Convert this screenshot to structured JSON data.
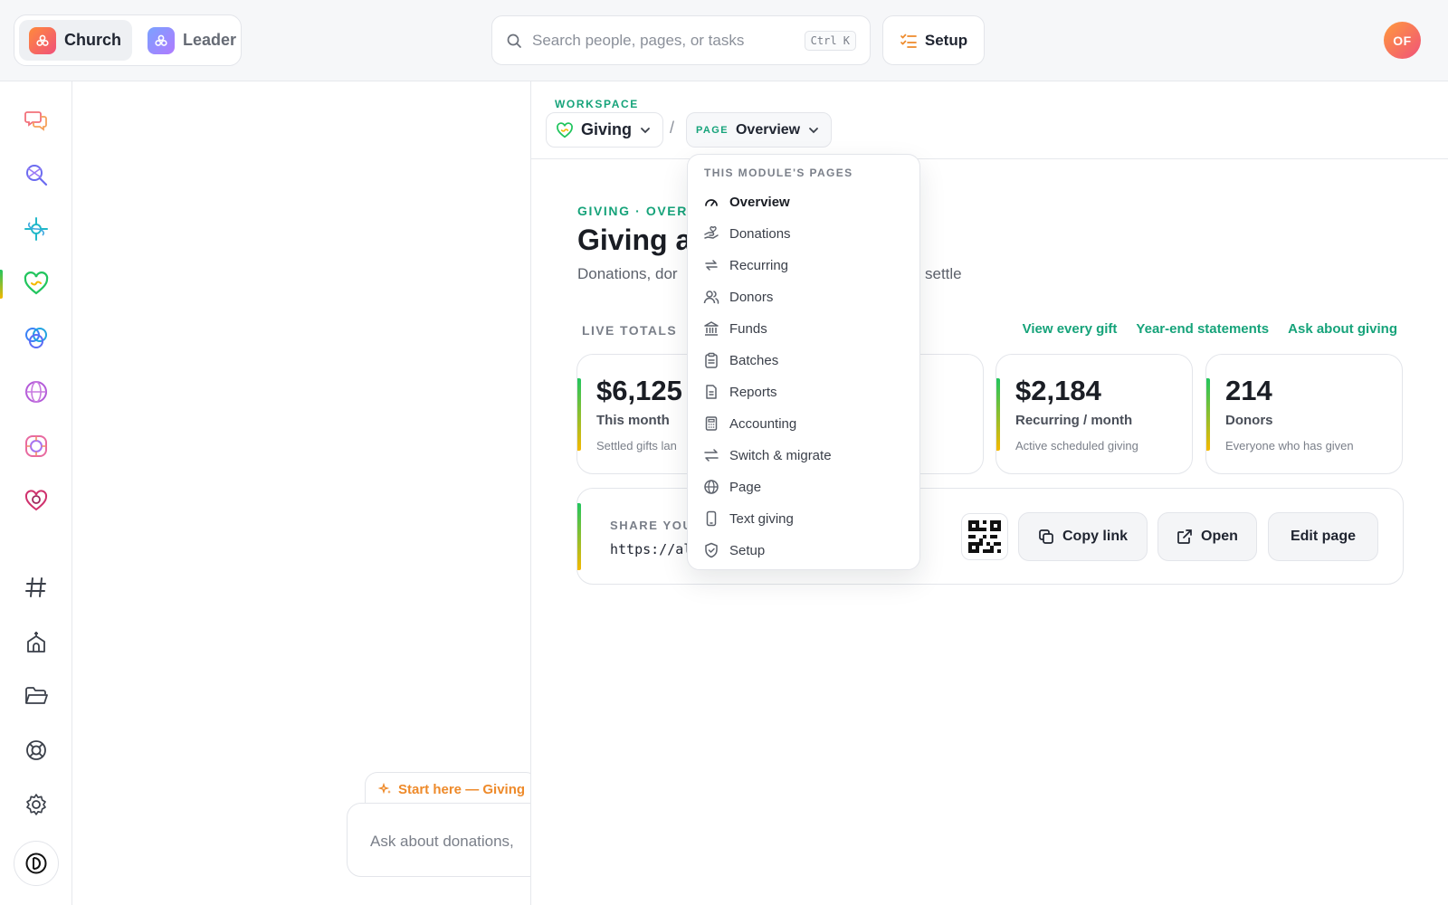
{
  "topbar": {
    "segments": [
      {
        "label": "Church",
        "active": true
      },
      {
        "label": "Leader",
        "active": false
      }
    ],
    "search_placeholder": "Search people, pages, or tasks",
    "search_shortcut": "Ctrl K",
    "setup_label": "Setup",
    "avatar_initials": "OF"
  },
  "breadcrumb": {
    "workspace_label": "WORKSPACE",
    "workspace": "Giving",
    "separator": "/",
    "page_tag": "PAGE",
    "page": "Overview"
  },
  "header": {
    "eyebrow": "GIVING · OVERVIEW",
    "title": "Giving a",
    "subtitle": "Donations, dor",
    "subtitle_end": "settle"
  },
  "live": {
    "label": "LIVE TOTALS",
    "links": [
      "View every gift",
      "Year-end statements",
      "Ask about giving"
    ]
  },
  "cards": [
    {
      "value": "$6,125",
      "label": "This month",
      "sub": "Settled gifts lan"
    },
    {
      "value": "$2,184",
      "label": "Recurring / month",
      "sub": "Active scheduled giving"
    },
    {
      "value": "214",
      "label": "Donors",
      "sub": "Everyone who has given"
    }
  ],
  "share": {
    "label": "SHARE YOU",
    "url": "https://al",
    "copy_label": "Copy link",
    "open_label": "Open",
    "edit_label": "Edit page"
  },
  "dropdown": {
    "heading": "THIS MODULE'S PAGES",
    "items": [
      {
        "label": "Overview",
        "icon": "gauge-icon",
        "selected": true
      },
      {
        "label": "Donations",
        "icon": "hand-heart-icon"
      },
      {
        "label": "Recurring",
        "icon": "repeat-icon"
      },
      {
        "label": "Donors",
        "icon": "users-icon"
      },
      {
        "label": "Funds",
        "icon": "bank-icon"
      },
      {
        "label": "Batches",
        "icon": "clipboard-icon"
      },
      {
        "label": "Reports",
        "icon": "report-icon"
      },
      {
        "label": "Accounting",
        "icon": "calculator-icon"
      },
      {
        "label": "Switch & migrate",
        "icon": "arrows-swap-icon"
      },
      {
        "label": "Page",
        "icon": "globe-icon"
      },
      {
        "label": "Text giving",
        "icon": "phone-icon"
      },
      {
        "label": "Setup",
        "icon": "shield-check-icon"
      }
    ]
  },
  "chat": {
    "tag": "Start here — Giving",
    "placeholder": "Ask about donations,"
  },
  "colors": {
    "accent_green": "#16a37a",
    "accent_orange": "#ee8a2a"
  }
}
